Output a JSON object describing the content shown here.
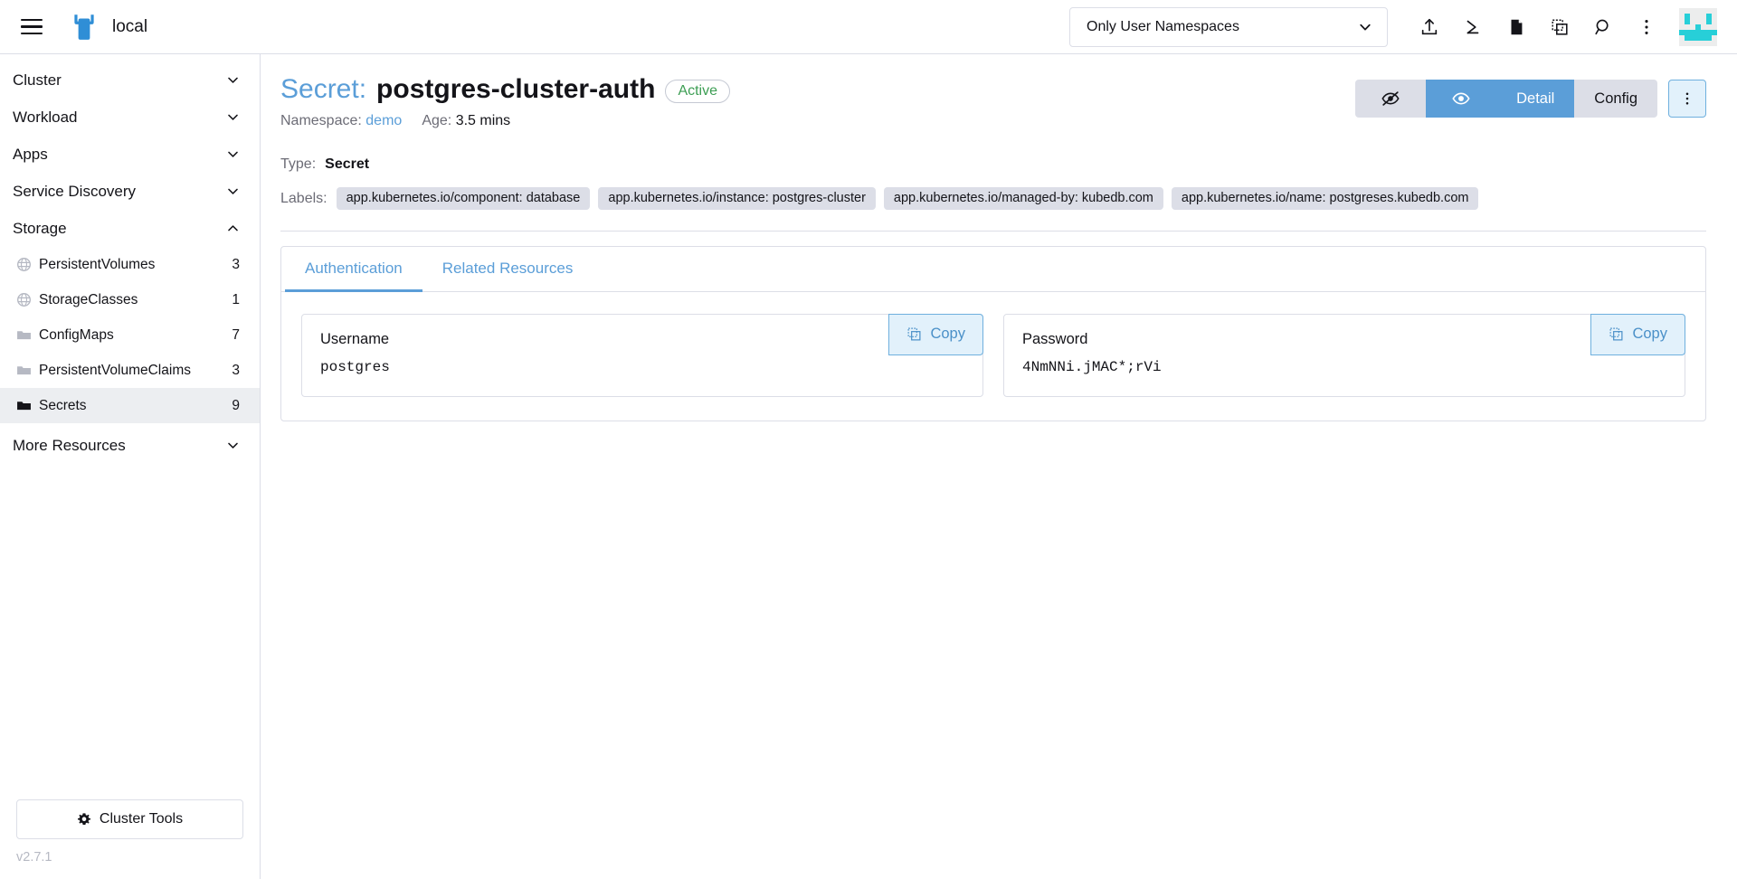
{
  "header": {
    "menu_icon": "hamburger-menu-icon",
    "logo_icon": "rancher-logo-icon",
    "cluster_name": "local",
    "namespace_filter": {
      "value": "Only User Namespaces",
      "chevron_icon": "chevron-down-icon"
    },
    "icons": [
      {
        "name": "import-yaml-icon",
        "title": "Import YAML"
      },
      {
        "name": "kubectl-shell-icon",
        "title": "Kubectl Shell"
      },
      {
        "name": "kubeconfig-file-icon",
        "title": "Kubeconfig File"
      },
      {
        "name": "copy-kubeconfig-icon",
        "title": "Copy KubeConfig"
      },
      {
        "name": "search-icon",
        "title": "Search"
      },
      {
        "name": "kebab-menu-icon",
        "title": "More"
      }
    ],
    "avatar_name": "user-avatar"
  },
  "sidebar": {
    "groups": [
      {
        "label": "Cluster",
        "expanded": false,
        "chevron": "chevron-down-icon"
      },
      {
        "label": "Workload",
        "expanded": false,
        "chevron": "chevron-down-icon"
      },
      {
        "label": "Apps",
        "expanded": false,
        "chevron": "chevron-down-icon"
      },
      {
        "label": "Service Discovery",
        "expanded": false,
        "chevron": "chevron-down-icon"
      },
      {
        "label": "Storage",
        "expanded": true,
        "chevron": "chevron-up-icon"
      }
    ],
    "storage_items": [
      {
        "label": "PersistentVolumes",
        "count": "3",
        "icon": "globe-icon",
        "active": false
      },
      {
        "label": "StorageClasses",
        "count": "1",
        "icon": "globe-icon",
        "active": false
      },
      {
        "label": "ConfigMaps",
        "count": "7",
        "icon": "folder-icon",
        "active": false
      },
      {
        "label": "PersistentVolumeClaims",
        "count": "3",
        "icon": "folder-icon",
        "active": false
      },
      {
        "label": "Secrets",
        "count": "9",
        "icon": "folder-icon",
        "active": true
      }
    ],
    "more_resources": {
      "label": "More Resources",
      "chevron": "chevron-down-icon"
    },
    "cluster_tools": {
      "label": "Cluster Tools",
      "icon": "gear-icon"
    },
    "version": "v2.7.1"
  },
  "page": {
    "kind": "Secret:",
    "name": "postgres-cluster-auth",
    "status_badge": "Active",
    "namespace_key": "Namespace:",
    "namespace_value": "demo",
    "age_key": "Age:",
    "age_value": "3.5 mins",
    "type_key": "Type:",
    "type_value": "Secret",
    "labels_key": "Labels:",
    "labels": [
      "app.kubernetes.io/component: database",
      "app.kubernetes.io/instance: postgres-cluster",
      "app.kubernetes.io/managed-by: kubedb.com",
      "app.kubernetes.io/name: postgreses.kubedb.com"
    ],
    "actions": {
      "hide_values_icon": "eye-slash-icon",
      "show_values_icon": "eye-icon",
      "detail_label": "Detail",
      "config_label": "Config",
      "kebab_icon": "kebab-menu-icon"
    }
  },
  "tabs": [
    {
      "label": "Authentication",
      "active": true
    },
    {
      "label": "Related Resources",
      "active": false
    }
  ],
  "credentials": [
    {
      "label": "Username",
      "value": "postgres",
      "copy_label": "Copy",
      "copy_icon": "copy-icon"
    },
    {
      "label": "Password",
      "value": "4NmNNi.jMAC*;rVi",
      "copy_label": "Copy",
      "copy_icon": "copy-icon"
    }
  ],
  "colors": {
    "accent": "#5b9ed8",
    "border": "#dcdee7",
    "chip_bg": "#dcdee7",
    "active_nav_bg": "#eceef1",
    "success": "#3d9e54",
    "copy_bg": "#e2f1fb",
    "copy_border": "#6fb0de",
    "avatar": "#27cfd8",
    "muted": "#6c6c76"
  }
}
